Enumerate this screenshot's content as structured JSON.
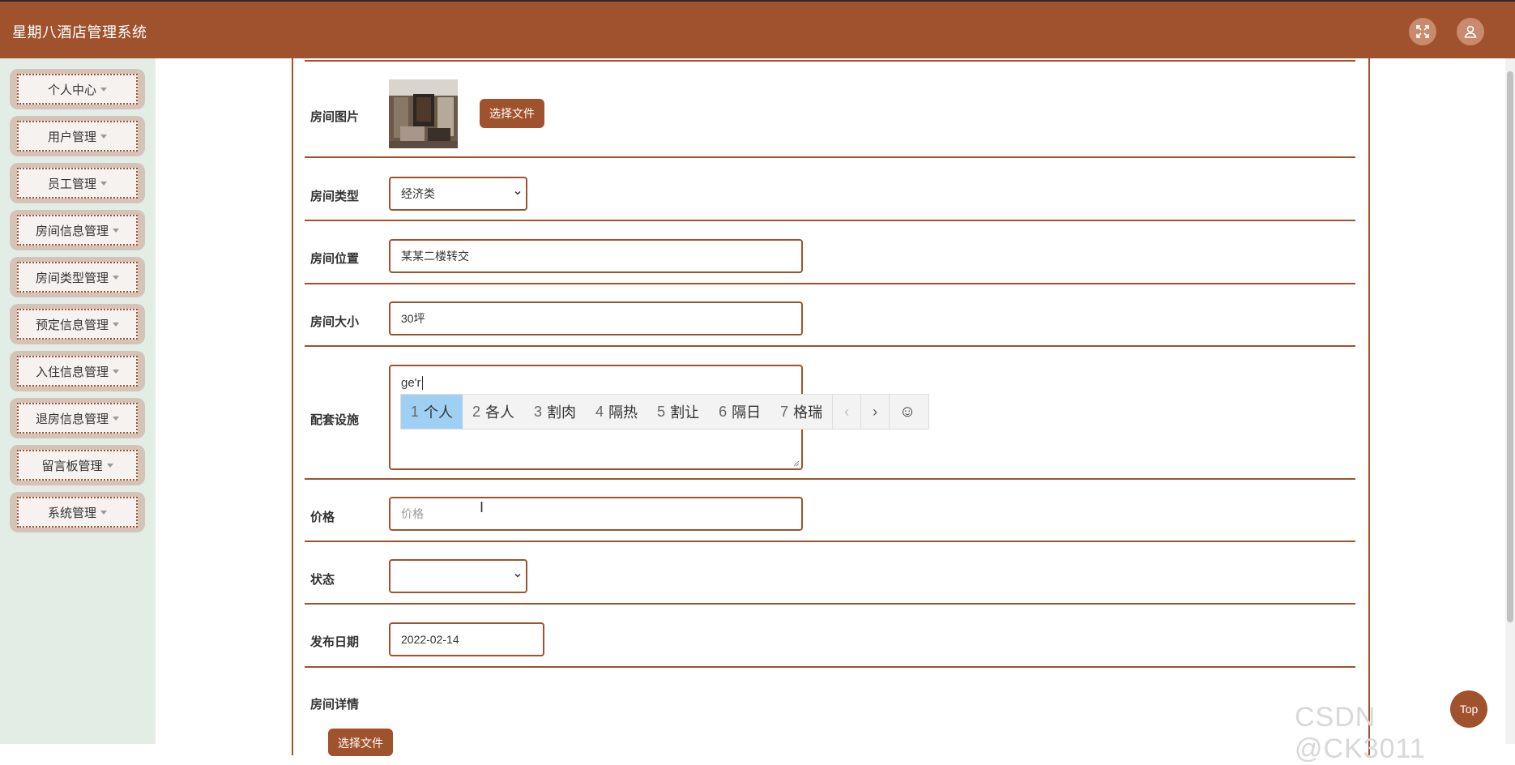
{
  "header": {
    "app_title": "星期八酒店管理系统",
    "icons": [
      "fullscreen-icon",
      "user-icon"
    ],
    "bg_color": "#a0522d"
  },
  "sidebar": {
    "items": [
      {
        "label": "个人中心"
      },
      {
        "label": "用户管理"
      },
      {
        "label": "员工管理"
      },
      {
        "label": "房间信息管理"
      },
      {
        "label": "房间类型管理"
      },
      {
        "label": "预定信息管理"
      },
      {
        "label": "入住信息管理"
      },
      {
        "label": "退房信息管理"
      },
      {
        "label": "留言板管理"
      },
      {
        "label": "系统管理"
      }
    ]
  },
  "form": {
    "room_image": {
      "label": "房间图片",
      "button": "选择文件"
    },
    "room_type": {
      "label": "房间类型",
      "value": "经济类"
    },
    "room_location": {
      "label": "房间位置",
      "value": "某某二楼转交"
    },
    "room_size": {
      "label": "房间大小",
      "value": "30坪"
    },
    "facilities": {
      "label": "配套设施",
      "value": "ge'r"
    },
    "price": {
      "label": "价格",
      "placeholder": "价格"
    },
    "status": {
      "label": "状态",
      "value": ""
    },
    "publish_date": {
      "label": "发布日期",
      "value": "2022-02-14"
    },
    "room_detail": {
      "label": "房间详情",
      "button": "选择文件"
    }
  },
  "ime": {
    "candidates": [
      {
        "num": "1",
        "text": "个人"
      },
      {
        "num": "2",
        "text": "各人"
      },
      {
        "num": "3",
        "text": "割肉"
      },
      {
        "num": "4",
        "text": "隔热"
      },
      {
        "num": "5",
        "text": "割让"
      },
      {
        "num": "6",
        "text": "隔日"
      },
      {
        "num": "7",
        "text": "格瑞"
      }
    ],
    "prev": "‹",
    "next": "›",
    "emoji": "☺",
    "selected_index": 0
  },
  "misc": {
    "watermark": "CSDN @CK3011",
    "top_button": "Top",
    "cursor": "I"
  }
}
